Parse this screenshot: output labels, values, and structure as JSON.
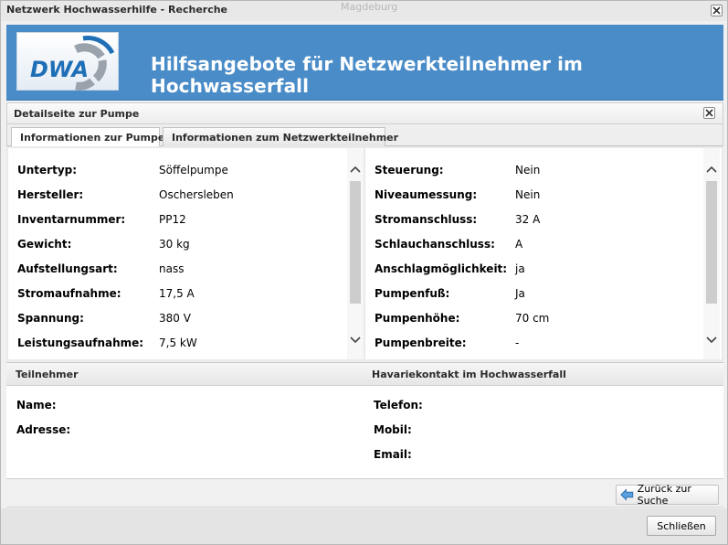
{
  "window": {
    "title": "Netzwerk Hochwasserhilfe - Recherche",
    "bg_map_label": "Magdeburg"
  },
  "banner": {
    "logo_text": "DWA",
    "title": "Hilfsangebote für Netzwerkteilnehmer im Hochwasserfall",
    "color": "#4a8cc8"
  },
  "panel": {
    "title": "Detailseite zur Pumpe"
  },
  "tabs": [
    {
      "label": "Informationen zur Pumpe",
      "active": true
    },
    {
      "label": "Informationen zum Netzwerkteilnehmer",
      "active": false
    }
  ],
  "details_left": [
    {
      "label": "Untertyp:",
      "value": "Söffelpumpe"
    },
    {
      "label": "Hersteller:",
      "value": "Oschersleben"
    },
    {
      "label": "Inventarnummer:",
      "value": "PP12"
    },
    {
      "label": "Gewicht:",
      "value": "30 kg"
    },
    {
      "label": "Aufstellungsart:",
      "value": "nass"
    },
    {
      "label": "Stromaufnahme:",
      "value": "17,5 A"
    },
    {
      "label": "Spannung:",
      "value": "380 V"
    },
    {
      "label": "Leistungsaufnahme:",
      "value": "7,5 kW"
    }
  ],
  "details_right": [
    {
      "label": "Steuerung:",
      "value": "Nein"
    },
    {
      "label": "Niveaumessung:",
      "value": "Nein"
    },
    {
      "label": "Stromanschluss:",
      "value": "32 A"
    },
    {
      "label": "Schlauchanschluss:",
      "value": "A"
    },
    {
      "label": "Anschlagmöglichkeit:",
      "value": "ja"
    },
    {
      "label": "Pumpenfuß:",
      "value": "Ja"
    },
    {
      "label": "Pumpenhöhe:",
      "value": "70 cm"
    },
    {
      "label": "Pumpenbreite:",
      "value": "-"
    }
  ],
  "sections": {
    "participant_header": "Teilnehmer",
    "emergency_header": "Havariekontakt im Hochwasserfall",
    "participant_fields": [
      {
        "label": "Name:",
        "value": ""
      },
      {
        "label": "Adresse:",
        "value": ""
      }
    ],
    "emergency_fields": [
      {
        "label": "Telefon:",
        "value": ""
      },
      {
        "label": "Mobil:",
        "value": ""
      },
      {
        "label": "Email:",
        "value": ""
      }
    ]
  },
  "buttons": {
    "back": "Zurück zur Suche",
    "close": "Schließen"
  }
}
